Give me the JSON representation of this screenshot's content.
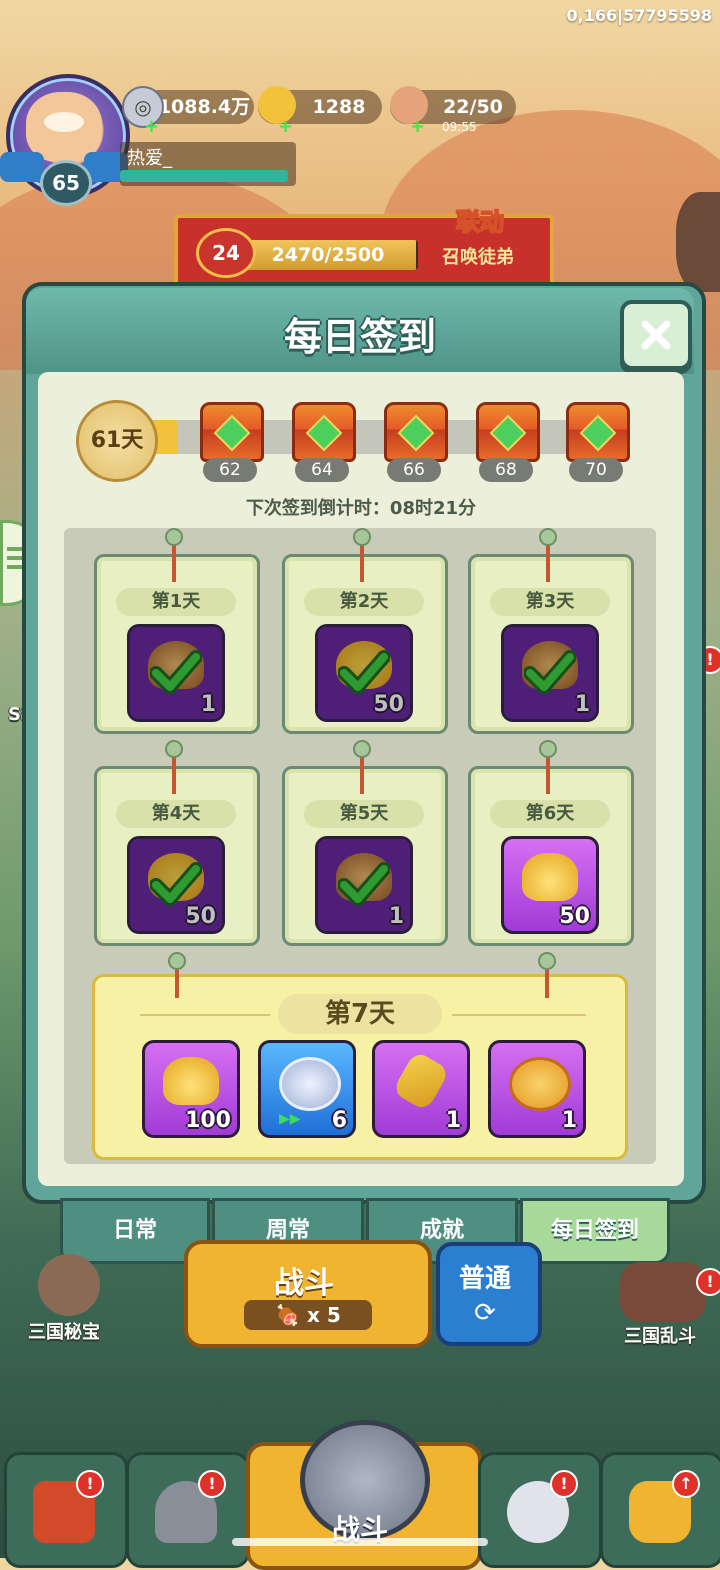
{
  "debug_id": "0,166|57795598",
  "player": {
    "level": "65",
    "name": "热爱_"
  },
  "resources": [
    {
      "name": "silver-coin",
      "value": "1088.4万"
    },
    {
      "name": "gold-ingot",
      "value": "1288"
    },
    {
      "name": "stamina-meat",
      "value": "22/50",
      "timer": "09:55"
    }
  ],
  "banner": {
    "level": "24",
    "progress": "2470/2500",
    "progress_fraction": 0.988,
    "tag": "联动",
    "subtitle": "召唤徒弟"
  },
  "panel": {
    "title": "每日签到",
    "streak_days": "61天",
    "milestones": [
      "62",
      "64",
      "66",
      "68",
      "70"
    ],
    "countdown": "下次签到倒计时：08时21分",
    "days": [
      {
        "label": "第1天",
        "icon": "food-icon",
        "qty": "1",
        "claimed": true
      },
      {
        "label": "第2天",
        "icon": "heart-icon",
        "qty": "50",
        "claimed": true
      },
      {
        "label": "第3天",
        "icon": "food-icon",
        "qty": "1",
        "claimed": true
      },
      {
        "label": "第4天",
        "icon": "heart-icon",
        "qty": "50",
        "claimed": true
      },
      {
        "label": "第5天",
        "icon": "food-icon",
        "qty": "1",
        "claimed": true
      },
      {
        "label": "第6天",
        "icon": "gold-ingot-icon",
        "qty": "50",
        "claimed": false
      }
    ],
    "day7": {
      "label": "第7天",
      "rewards": [
        {
          "icon": "gold-ingot-icon",
          "qty": "100"
        },
        {
          "icon": "silver-coin-icon",
          "qty": "6"
        },
        {
          "icon": "key-icon",
          "qty": "1"
        },
        {
          "icon": "medal-icon",
          "qty": "1"
        }
      ]
    }
  },
  "tabs": [
    "日常",
    "周常",
    "成就",
    "每日签到"
  ],
  "active_tab": "每日签到",
  "battle": {
    "label": "战斗",
    "cost": "x 5"
  },
  "mode": {
    "label": "普通"
  },
  "side": {
    "left": "三国秘宝",
    "right": "三国乱斗",
    "left_partial": "SS"
  },
  "nav": {
    "center_label": "战斗"
  },
  "colors": {
    "panel": "#5fa59a",
    "active_tab": "#a7d99a",
    "badge": "#e0302a"
  }
}
